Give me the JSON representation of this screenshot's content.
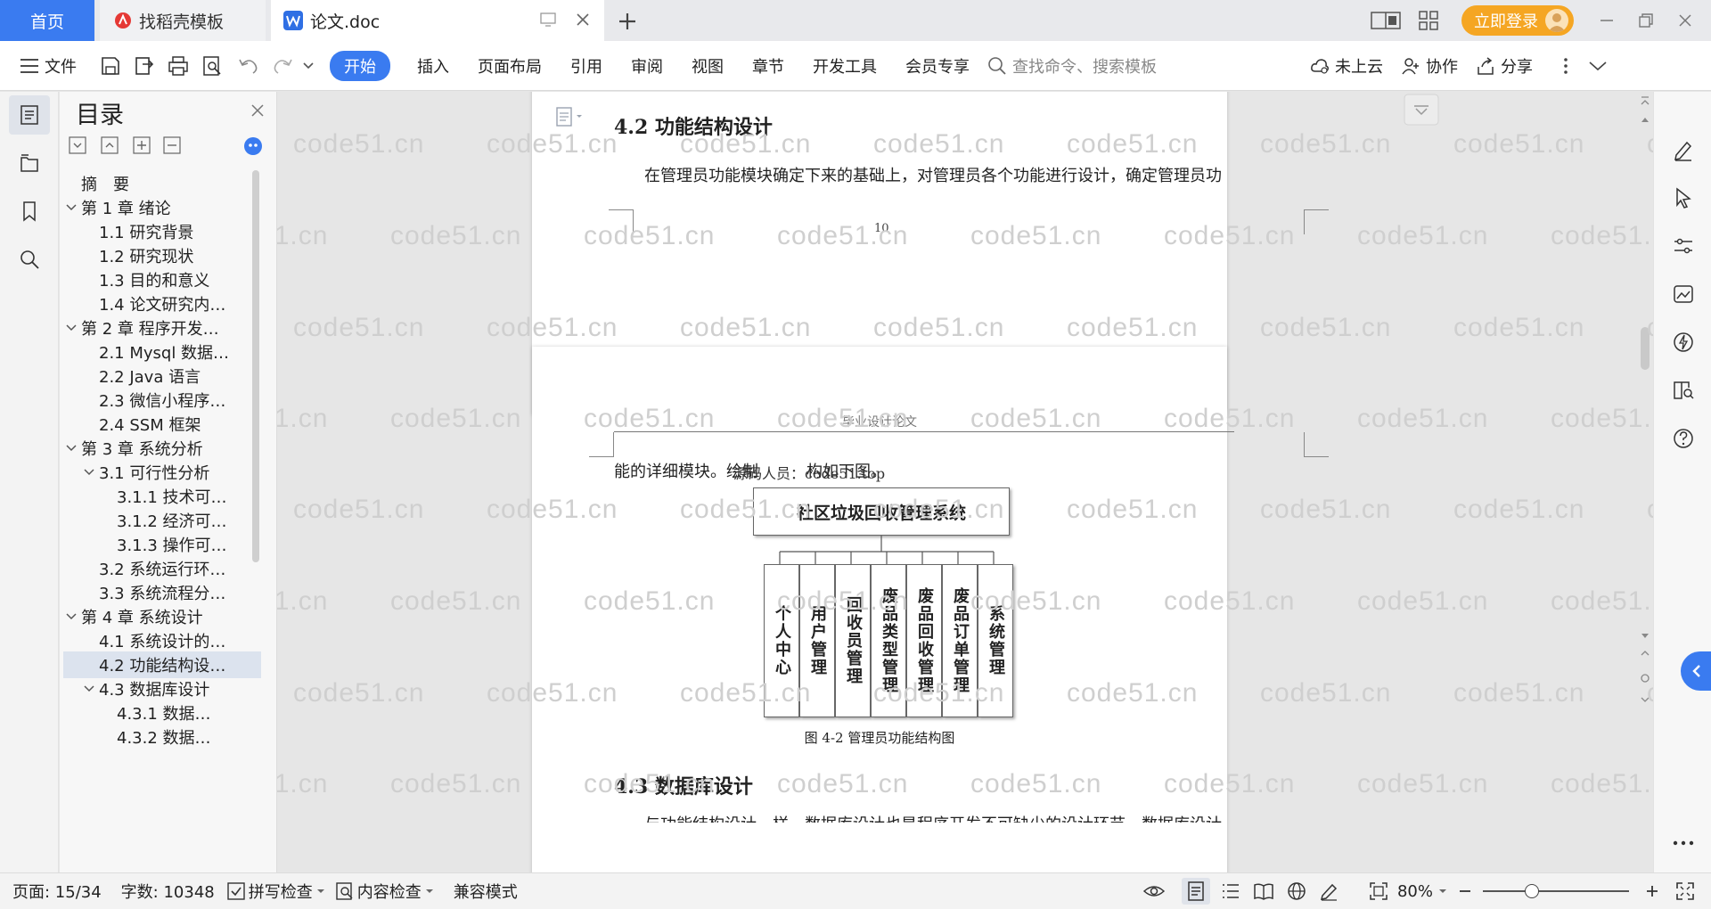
{
  "tabs": {
    "home": "首页",
    "daoke": "找稻壳模板",
    "doc": "论文.doc",
    "login": "立即登录"
  },
  "ribbon": {
    "file": "文件",
    "start": "开始",
    "insert": "插入",
    "layout": "页面布局",
    "ref": "引用",
    "review": "审阅",
    "view": "视图",
    "chapter": "章节",
    "dev": "开发工具",
    "member": "会员专享",
    "search_placeholder": "查找命令、搜索模板",
    "cloud": "未上云",
    "collab": "协作",
    "share": "分享"
  },
  "toc": {
    "title": "目录",
    "items": [
      {
        "label": "摘　要",
        "caret": ""
      },
      {
        "label": "第 1 章  绪论",
        "caret": "v"
      },
      {
        "label": "1.1  研究背景",
        "caret": ""
      },
      {
        "label": "1.2  研究现状",
        "caret": ""
      },
      {
        "label": "1.3  目的和意义",
        "caret": ""
      },
      {
        "label": "1.4  论文研究内…",
        "caret": ""
      },
      {
        "label": "第 2 章  程序开发…",
        "caret": "v"
      },
      {
        "label": "2.1 Mysql 数据…",
        "caret": ""
      },
      {
        "label": "2.2 Java 语言",
        "caret": ""
      },
      {
        "label": "2.3  微信小程序…",
        "caret": ""
      },
      {
        "label": "2.4 SSM 框架",
        "caret": ""
      },
      {
        "label": "第 3 章  系统分析",
        "caret": "v"
      },
      {
        "label": "3.1 可行性分析",
        "caret": "v"
      },
      {
        "label": "3.1.1 技术可…",
        "caret": ""
      },
      {
        "label": "3.1.2 经济可…",
        "caret": ""
      },
      {
        "label": "3.1.3 操作可…",
        "caret": ""
      },
      {
        "label": "3.2 系统运行环…",
        "caret": ""
      },
      {
        "label": "3.3 系统流程分…",
        "caret": ""
      },
      {
        "label": "第 4 章  系统设计",
        "caret": "v"
      },
      {
        "label": "4.1  系统设计的…",
        "caret": ""
      },
      {
        "label": "4.2  功能结构设…",
        "caret": ""
      },
      {
        "label": "4.3  数据库设计",
        "caret": "v"
      },
      {
        "label": "4.3.1  数据…",
        "caret": ""
      },
      {
        "label": "4.3.2  数据…",
        "caret": ""
      }
    ]
  },
  "doc": {
    "heading42": "4.2  功能结构设计",
    "para1": "在管理员功能模块确定下来的基础上，对管理员各个功能进行设计，确定管理员功",
    "page_number": "10",
    "header_text": "毕业设计论文",
    "para2_a": "能的详细模块。绘制",
    "para2_overlap": "源码人员：code51.top",
    "para2_b": "构如下图。",
    "root_box": "社区垃圾回收管理系统",
    "modules": [
      "个人中心",
      "用户管理",
      "回收员管理",
      "废品类型管理",
      "废品回收管理",
      "废品订单管理",
      "系统管理"
    ],
    "caption": "图 4-2  管理员功能结构图",
    "heading43": "4.3  数据库设计",
    "para3": "与功能结构设计一样，数据库设计也是程序开发不可缺少的设计环节。数据库设计",
    "watermark": "code51.cn"
  },
  "status": {
    "page": "页面: 15/34",
    "words": "字数: 10348",
    "spell": "拼写检查",
    "content": "内容检查",
    "compat": "兼容模式",
    "zoom": "80%"
  },
  "colors": {
    "accent": "#3a7bf0",
    "login": "#f5a623"
  }
}
